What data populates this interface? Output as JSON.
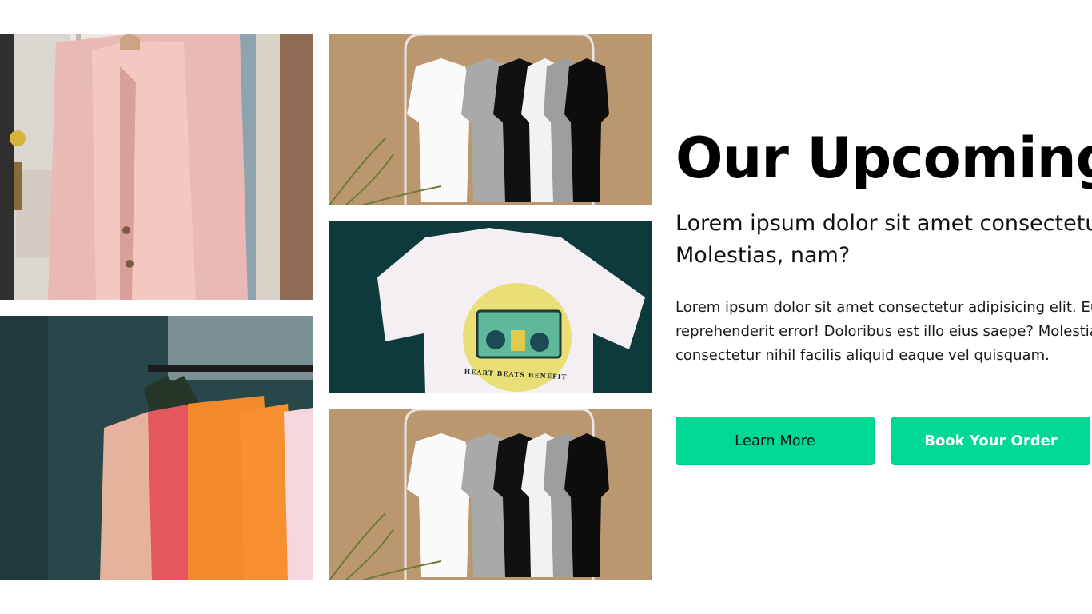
{
  "hero": {
    "headline": "Our Upcoming",
    "subtitle": "Lorem ipsum dolor sit amet consectetur Molestias, nam?",
    "body": "Lorem ipsum dolor sit amet consectetur adipisicing elit. Eum reprehenderit error! Doloribus est illo eius saepe? Molestias consectetur nihil facilis aliquid eaque vel quisquam.",
    "buttons": {
      "learn_more": "Learn More",
      "book_order": "Book Your Order"
    }
  },
  "gallery": {
    "tshirt_print_text": "HEART BEATS BENEFIT"
  },
  "colors": {
    "accent": "#00d994",
    "teal_bg": "#0f3b3d",
    "kraft_bg": "#b9956f"
  }
}
